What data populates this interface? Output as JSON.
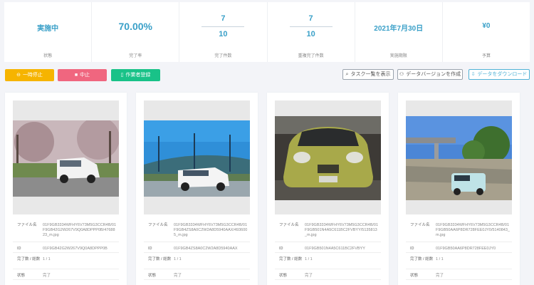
{
  "stats": [
    {
      "value": "実施中",
      "label": "状態"
    },
    {
      "value": "70.00%",
      "label": "完了率"
    },
    {
      "numerator": "7",
      "denominator": "10",
      "label": "完了件数"
    },
    {
      "numerator": "7",
      "denominator": "10",
      "label": "重複完了件数"
    },
    {
      "value": "2021年7月30日",
      "label": "実施期限"
    },
    {
      "value": "¥0",
      "label": "予算"
    }
  ],
  "toolbar": {
    "pause": "一時停止",
    "stop": "中止",
    "register": "作業者登録",
    "show_tasks": "タスク一覧を表示",
    "create_version": "データバージョンを作成",
    "download": "データをダウンロード"
  },
  "meta_labels": {
    "filename": "ファイル名",
    "id": "ID",
    "progress": "完了数 / 総数",
    "status": "状態"
  },
  "cards": [
    {
      "filename": "01F9GB3334WFHY6V73M5G3CCR4B/01F9GB42G2W267V9Q0A8DPPP0B/4768823_m.jpg",
      "id": "01F9GB42G2W267V9Q0A8DPPP0B",
      "progress": "1 / 1",
      "status": "完了"
    },
    {
      "filename": "01F9GB3334WFHY6V73M5G3CCR4B/01F9GB4ZS8A0C2W2A8D5940AAX/4936005_m.jpg",
      "id": "01F9GB4ZS8A0C2W2A8D5940AAX",
      "progress": "1 / 1",
      "status": "完了"
    },
    {
      "filename": "01F9GB3334WFHY6V73M5G3CCR4B/01F9GB501N4A5C611BC2FVBYY/5135813_m.jpg",
      "id": "01F9GB501N4A5C611BC2FVBYY",
      "progress": "1 / 1",
      "status": "完了"
    },
    {
      "filename": "01F9GB3334WFHY6V73M5G3CCR4B/01F9GB50AA6P8DR728FEE0JY0/5140843_m.jpg",
      "id": "01F9GB50AA6P8DR728FEE0JY0",
      "progress": "1 / 1",
      "status": "完了"
    }
  ]
}
